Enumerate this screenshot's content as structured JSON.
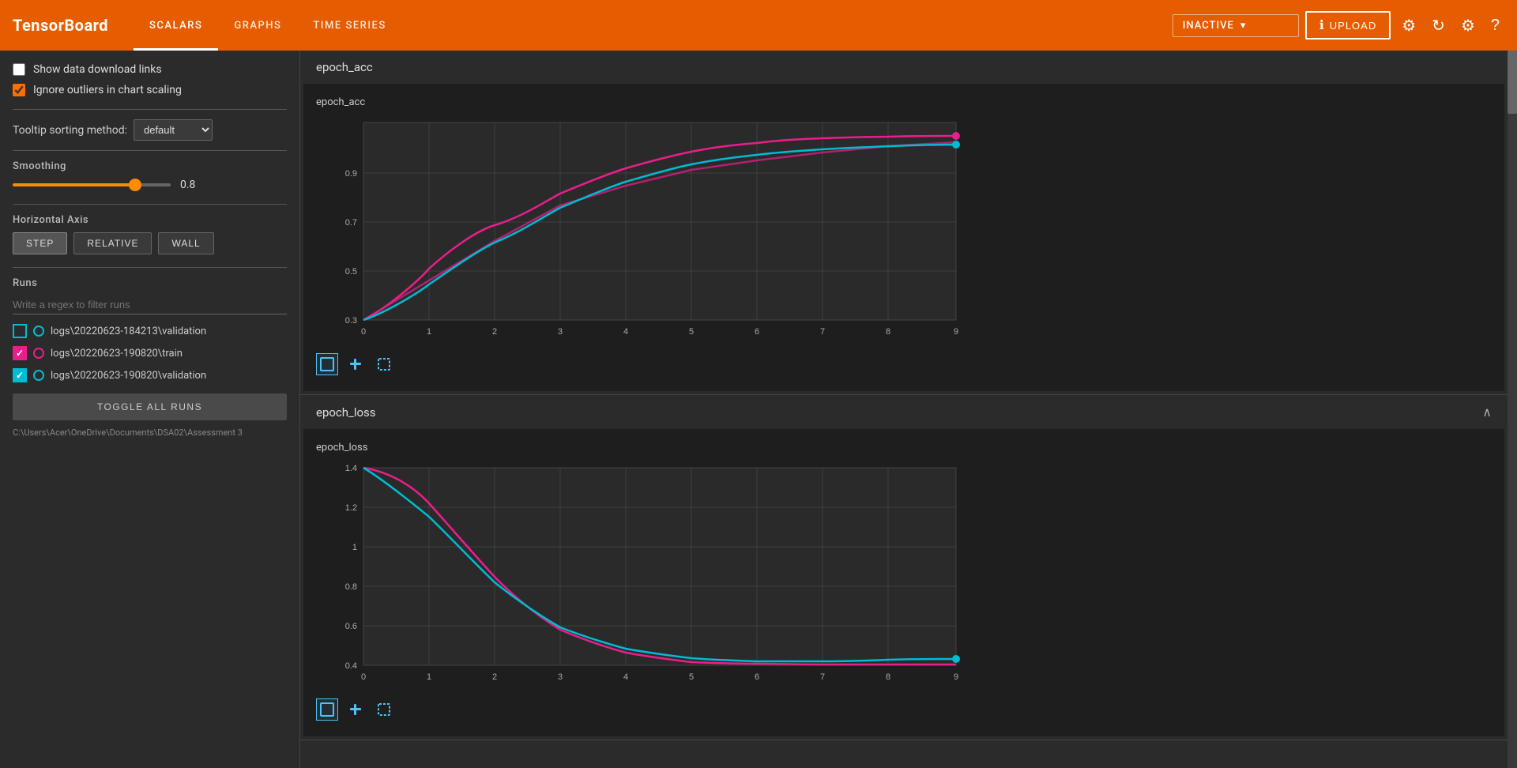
{
  "header": {
    "logo": "TensorBoard",
    "nav": [
      {
        "label": "SCALARS",
        "active": true
      },
      {
        "label": "GRAPHS",
        "active": false
      },
      {
        "label": "TIME SERIES",
        "active": false
      }
    ],
    "inactive_label": "INACTIVE",
    "upload_label": "UPLOAD",
    "icons": [
      "settings-dark",
      "refresh",
      "settings",
      "help"
    ]
  },
  "sidebar": {
    "show_download": "Show data download links",
    "ignore_outliers": "Ignore outliers in chart scaling",
    "tooltip_label": "Tooltip sorting method:",
    "tooltip_default": "default",
    "smoothing_label": "Smoothing",
    "smoothing_value": "0.8",
    "h_axis_label": "Horizontal Axis",
    "axis_buttons": [
      "STEP",
      "RELATIVE",
      "WALL"
    ],
    "active_axis": "STEP",
    "runs_label": "Runs",
    "runs_filter_placeholder": "Write a regex to filter runs",
    "runs": [
      {
        "label": "logs\\20220623-184213\\validation",
        "color_border": "#00bcd4",
        "checked": false,
        "dot_color": "#00bcd4"
      },
      {
        "label": "logs\\20220623-190820\\train",
        "color_border": "#e91e8c",
        "checked": true,
        "dot_color": "#e91e8c"
      },
      {
        "label": "logs\\20220623-190820\\validation",
        "color_border": "#00bcd4",
        "checked": true,
        "dot_color": "#00bcd4"
      }
    ],
    "toggle_all_label": "TOGGLE ALL RUNS",
    "path_text": "C:\\Users\\Acer\\OneDrive\\Documents\\DSA02\\Assessment 3"
  },
  "charts": [
    {
      "section_title": "epoch_acc",
      "chart_title": "epoch_acc",
      "collapsed": false,
      "x_labels": [
        "0",
        "1",
        "2",
        "3",
        "4",
        "5",
        "6",
        "7",
        "8",
        "9"
      ],
      "y_labels": [
        "0.3",
        "0.5",
        "0.7",
        "0.9"
      ],
      "series": [
        {
          "color": "#e91e8c",
          "type": "smooth"
        },
        {
          "color": "#00bcd4",
          "type": "smooth"
        }
      ]
    },
    {
      "section_title": "epoch_loss",
      "chart_title": "epoch_loss",
      "collapsed": false,
      "x_labels": [
        "0",
        "1",
        "2",
        "3",
        "4",
        "5",
        "6",
        "7",
        "8",
        "9"
      ],
      "y_labels": [
        "0.4",
        "0.6",
        "0.8",
        "1",
        "1.2",
        "1.4"
      ],
      "series": [
        {
          "color": "#e91e8c",
          "type": "smooth"
        },
        {
          "color": "#00bcd4",
          "type": "smooth"
        }
      ]
    }
  ]
}
